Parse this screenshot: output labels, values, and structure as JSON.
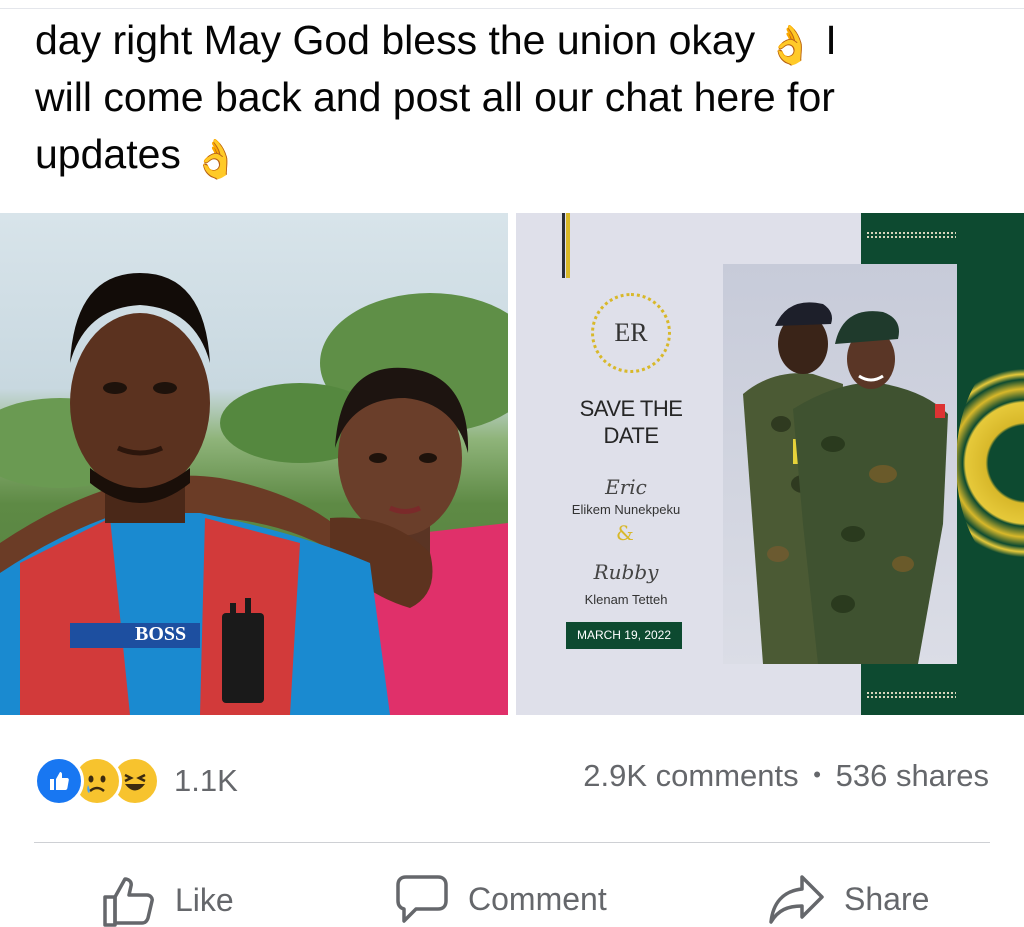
{
  "post": {
    "text_line1": "day right May God bless the union okay",
    "text_line1_end": " I",
    "text_line2": "will come back and post all our chat here for",
    "text_line3": "updates",
    "emoji": "👌"
  },
  "photos": {
    "left": {
      "shirt_text": "BOSS"
    },
    "right": {
      "monogram": "ER",
      "heading_line1": "SAVE THE",
      "heading_line2": "DATE",
      "name1_script": "Eric",
      "name1": "Elikem Nunekpeku",
      "ampersand": "&",
      "name2_script": "Rubby",
      "name2": "Klenam Tetteh",
      "date": "MARCH 19, 2022"
    }
  },
  "engagement": {
    "reaction_icons": [
      "like-icon",
      "sad-icon",
      "haha-icon"
    ],
    "reaction_count": "1.1K",
    "comments": "2.9K comments",
    "separator": "•",
    "shares": "536 shares"
  },
  "actions": {
    "like_label": "Like",
    "comment_label": "Comment",
    "share_label": "Share"
  },
  "colors": {
    "facebook_blue": "#1877f2",
    "secondary_text": "#65676b",
    "card_green": "#0d4a30",
    "card_gold": "#d8b82a"
  }
}
